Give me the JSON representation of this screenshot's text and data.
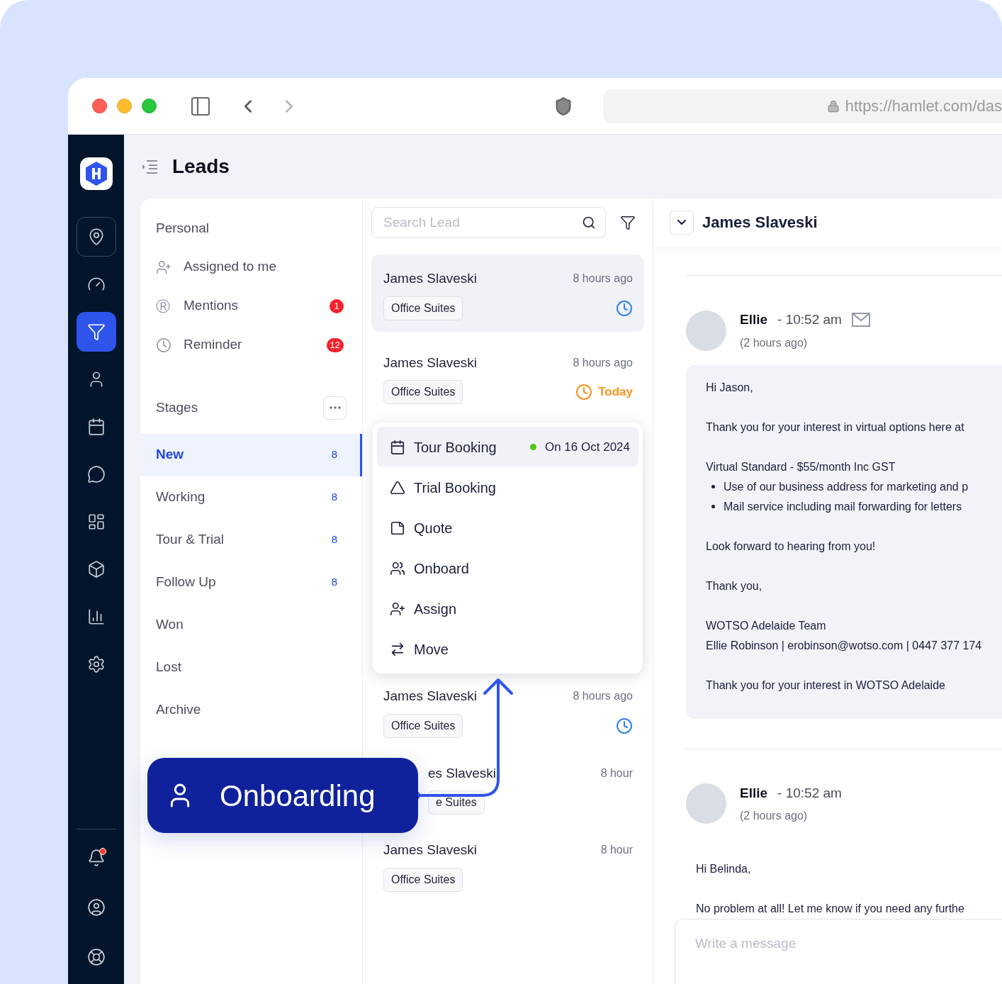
{
  "browser": {
    "url": "https://hamlet.com/das"
  },
  "sidebar": {
    "items": [
      {
        "selected": false,
        "outlined": true
      },
      {
        "selected": false,
        "outlined": false
      },
      {
        "selected": true,
        "outlined": false
      },
      {
        "selected": false,
        "outlined": false
      },
      {
        "selected": false,
        "outlined": false
      },
      {
        "selected": false,
        "outlined": false
      },
      {
        "selected": false,
        "outlined": false
      },
      {
        "selected": false,
        "outlined": false
      },
      {
        "selected": false,
        "outlined": false
      },
      {
        "selected": false,
        "outlined": false
      }
    ],
    "bottom_items": [
      {
        "unread": true
      },
      {
        "unread": false
      },
      {
        "unread": false
      }
    ]
  },
  "page": {
    "title": "Leads"
  },
  "filters": {
    "personal": {
      "title": "Personal",
      "items": [
        {
          "label": "Assigned to me"
        },
        {
          "label": "Mentions",
          "glyph": "Ⓡ",
          "count": "1"
        },
        {
          "label": "Reminder",
          "count": "12"
        }
      ]
    },
    "stages": {
      "title": "Stages",
      "items": [
        {
          "label": "New",
          "count": "8",
          "selected": true
        },
        {
          "label": "Working",
          "count": "8",
          "selected": false
        },
        {
          "label": "Tour & Trial",
          "count": "8",
          "selected": false
        },
        {
          "label": "Follow Up",
          "count": "8",
          "selected": false
        },
        {
          "label": "Won",
          "selected": false
        },
        {
          "label": "Lost",
          "selected": false
        },
        {
          "label": "Archive",
          "selected": false
        }
      ]
    }
  },
  "leads": {
    "search": {
      "placeholder": "Search Lead"
    },
    "cards_top": [
      {
        "name": "James Slaveski",
        "time": "8 hours ago",
        "tag": "Office Suites",
        "selected": true,
        "reminder": {
          "kind": "upcoming"
        }
      },
      {
        "name": "James Slaveski",
        "time": "8 hours ago",
        "tag": "Office Suites",
        "selected": false,
        "reminder": {
          "kind": "today",
          "label": "Today"
        }
      }
    ],
    "menu": [
      {
        "label": "Tour Booking",
        "selected": true,
        "date": "On 16 Oct 2024",
        "color": "#52c41a"
      },
      {
        "label": "Trial Booking",
        "selected": false
      },
      {
        "label": "Quote",
        "selected": false
      },
      {
        "label": "Onboard",
        "selected": false
      },
      {
        "label": "Assign",
        "selected": false
      },
      {
        "label": "Move",
        "selected": false
      }
    ],
    "cards_bottom": [
      {
        "name": "James Slaveski",
        "time": "8 hours ago",
        "tag": "Office Suites",
        "selected": false,
        "reminder": {
          "kind": "upcoming"
        }
      },
      {
        "name": "es Slaveski",
        "time": "8 hour",
        "tag": "e Suites",
        "selected": false,
        "covered": true
      },
      {
        "name": "James Slaveski",
        "time": "8 hour",
        "tag": "Office Suites",
        "selected": false
      }
    ]
  },
  "callout": {
    "label": "Onboarding"
  },
  "detail": {
    "title": "James Slaveski",
    "messages": [
      {
        "author": "Ellie",
        "time": "- 10:52 am",
        "ago": "(2 hours ago)",
        "email": true,
        "boxed": true,
        "blocks": [
          {
            "lines": [
              "Hi Jason,"
            ]
          },
          {
            "lines": [
              "Thank you for your interest in virtual options here at"
            ]
          },
          {
            "lines": [
              "Virtual Standard - $55/month Inc GST"
            ],
            "bullets": [
              "Use of our business address for marketing and p",
              "Mail service including mail forwarding for letters"
            ]
          },
          {
            "lines": [
              "Look forward to hearing from you!"
            ]
          },
          {
            "lines": [
              "Thank you,"
            ]
          },
          {
            "lines": [
              "WOTSO Adelaide Team",
              "Ellie Robinson | erobinson@wotso.com | 0447 377 174"
            ]
          },
          {
            "lines": [
              "Thank you for your interest in WOTSO Adelaide"
            ]
          }
        ]
      },
      {
        "author": "Ellie",
        "time": "- 10:52 am",
        "ago": "(2 hours ago)",
        "email": false,
        "boxed": false,
        "blocks": [
          {
            "lines": [
              "Hi Belinda,"
            ]
          },
          {
            "lines": [
              "No problem at all! Let me know if you need any furthe"
            ]
          }
        ]
      }
    ],
    "composer": {
      "placeholder": "Write a message"
    }
  }
}
